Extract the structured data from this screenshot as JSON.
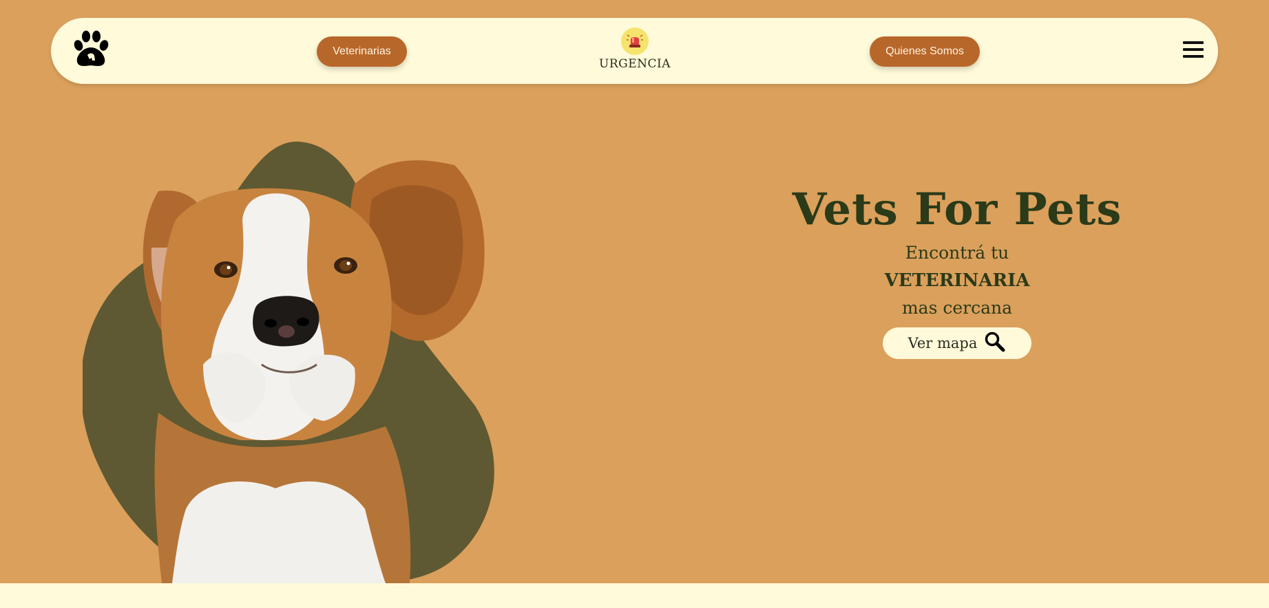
{
  "nav": {
    "logo_icon": "paw-print-icon",
    "veterinarias_label": "Veterinarias",
    "urgencia_icon": "siren-icon",
    "urgencia_label": "URGENCIA",
    "quienes_somos_label": "Quienes Somos",
    "menu_icon": "hamburger-menu-icon"
  },
  "hero": {
    "title": "Vets For Pets",
    "line1": "Encontrá tu",
    "line2": "VETERINARIA",
    "line3": "mas cercana",
    "map_button_label": "Ver mapa",
    "map_button_icon": "search-icon",
    "image": "beagle-photo"
  },
  "colors": {
    "background": "#DBA05C",
    "navbar": "#FFFAD9",
    "button": "#B8672A",
    "blob": "#5E5932",
    "title": "#2B3A18"
  }
}
